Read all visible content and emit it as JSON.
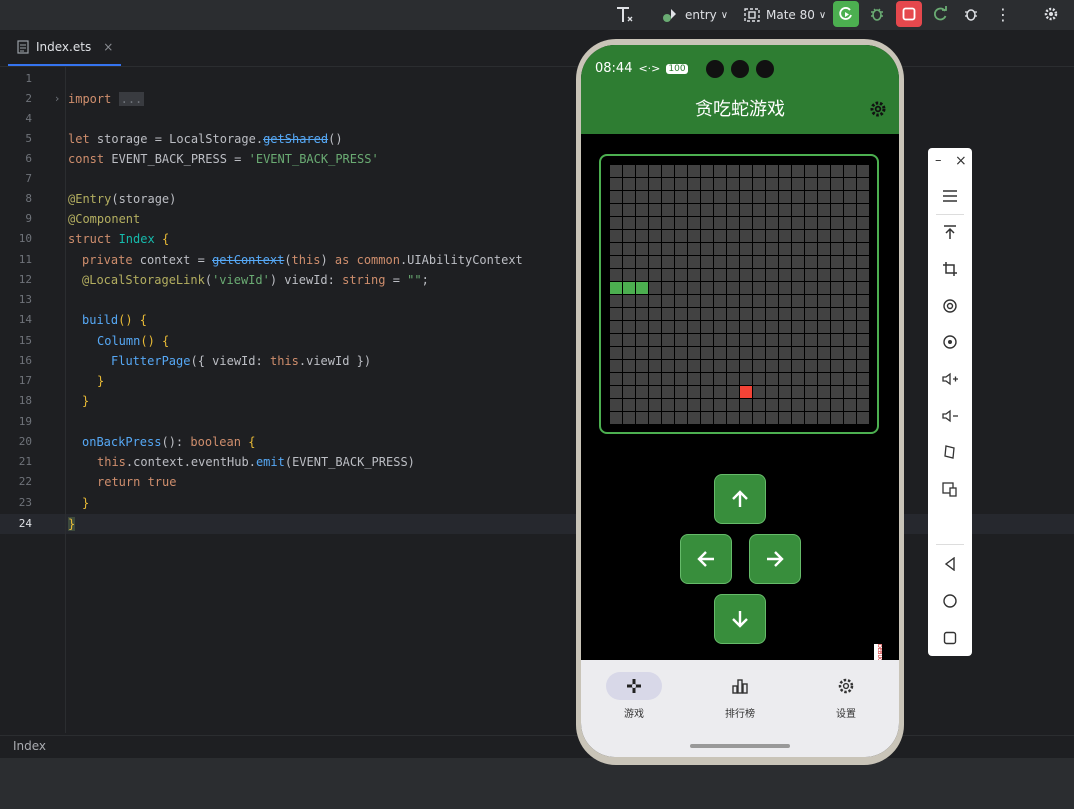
{
  "toolbar": {
    "module": "entry",
    "device": "Mate 80"
  },
  "editor_tab": {
    "filename": "Index.ets"
  },
  "code": {
    "import_kw": "import",
    "import_fold": "...",
    "l5_let": "let",
    "l5_var": " storage = LocalStorage.",
    "l5_fn": "getShared",
    "l5_end": "()",
    "l6_const": "const",
    "l6_name": " EVENT_BACK_PRESS = ",
    "l6_str": "'EVENT_BACK_PRESS'",
    "l8_ann": "@Entry",
    "l8_rest": "(storage)",
    "l9_ann": "@Component",
    "l10_kw": "struct",
    "l10_name": " Index ",
    "l10_brace": "{",
    "l11_kw": "private",
    "l11_a": " context = ",
    "l11_fn": "getContext",
    "l11_b": "(",
    "l11_this": "this",
    "l11_c": ") ",
    "l11_as": "as",
    "l11_d": " ",
    "l11_common": "common",
    "l11_e": ".UIAbilityContext",
    "l12_ann": "@LocalStorageLink",
    "l12_a": "(",
    "l12_str": "'viewId'",
    "l12_b": ") viewId: ",
    "l12_type": "string",
    "l12_c": " = ",
    "l12_str2": "\"\"",
    "l12_d": ";",
    "l14_fn": "build",
    "l14_rest": "() {",
    "l15_fn": "Column",
    "l15_rest": "() {",
    "l16_fn": "FlutterPage",
    "l16_a": "({ viewId: ",
    "l16_this": "this",
    "l16_b": ".viewId })",
    "l17": "}",
    "l18": "}",
    "l20_fn": "onBackPress",
    "l20_a": "(): ",
    "l20_type": "boolean",
    "l20_b": " {",
    "l21_this": "this",
    "l21_a": ".context.eventHub.",
    "l21_fn": "emit",
    "l21_b": "(EVENT_BACK_PRESS)",
    "l22_kw": "return",
    "l22_true": " true",
    "l23": "}",
    "l24": "}"
  },
  "line_numbers": [
    "1",
    "2",
    "4",
    "5",
    "6",
    "7",
    "8",
    "9",
    "10",
    "11",
    "12",
    "13",
    "14",
    "15",
    "16",
    "17",
    "18",
    "19",
    "20",
    "21",
    "22",
    "23",
    "24"
  ],
  "statusbar": {
    "breadcrumb": "Index"
  },
  "phone": {
    "time": "08:44",
    "net": "<·>",
    "battery": "100",
    "app_title": "贪吃蛇游戏",
    "debug_badge": "DEBUG",
    "nav": [
      {
        "label": "游戏"
      },
      {
        "label": "排行榜"
      },
      {
        "label": "设置"
      }
    ]
  },
  "game": {
    "grid_size": 20,
    "snake": [
      [
        0,
        9
      ],
      [
        1,
        9
      ],
      [
        2,
        9
      ]
    ],
    "food": [
      10,
      17
    ]
  },
  "colors": {
    "appbar": "#2e7d32",
    "snake": "#4caf50",
    "food": "#f44336",
    "cell": "#424242",
    "button": "#388e3c"
  }
}
